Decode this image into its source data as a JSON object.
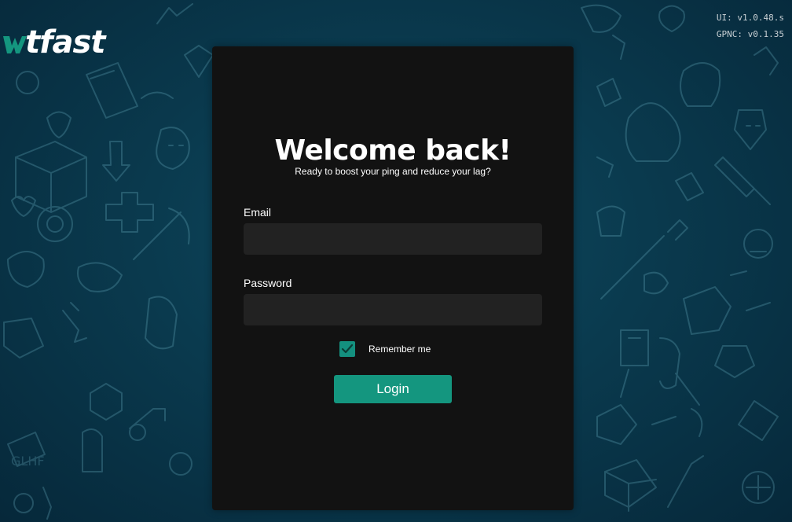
{
  "brand": {
    "name": "tfast",
    "logo_icon": "wtfast-w-logo"
  },
  "versions": {
    "ui": "UI: v1.0.48.s",
    "gpnc": "GPNC: v0.1.35"
  },
  "login": {
    "title": "Welcome back!",
    "subtitle": "Ready to boost your ping and reduce your lag?",
    "email_label": "Email",
    "email_value": "",
    "password_label": "Password",
    "password_value": "",
    "remember_label": "Remember me",
    "remember_checked": true,
    "submit_label": "Login"
  },
  "colors": {
    "accent": "#14967f",
    "card_bg": "#121212",
    "input_bg": "#222222",
    "background": "#0a3a4e"
  }
}
